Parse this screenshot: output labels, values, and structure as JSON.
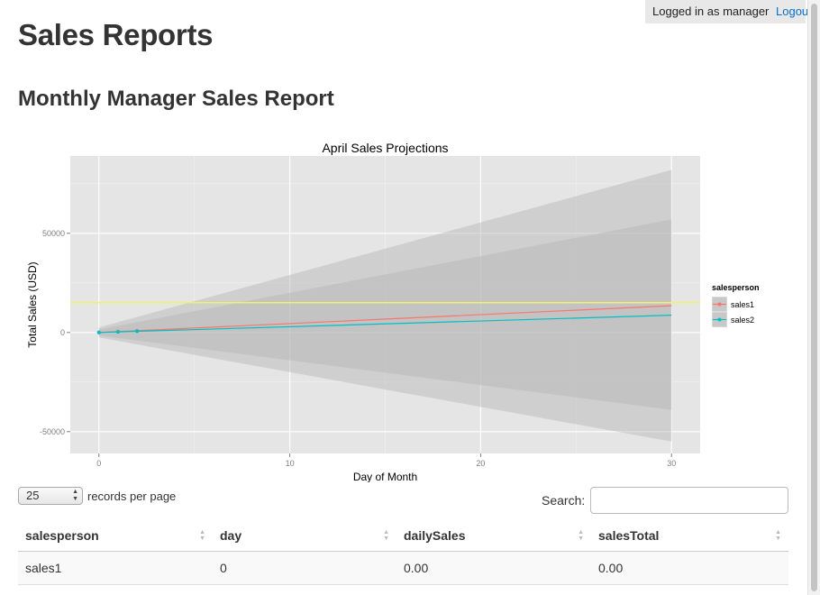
{
  "header": {
    "login_text": "Logged in as manager",
    "logout_label": "Logout",
    "page_title": "Sales Reports",
    "report_title": "Monthly Manager Sales Report"
  },
  "chart_data": {
    "type": "line",
    "title": "April Sales Projections",
    "xlabel": "Day of Month",
    "ylabel": "Total Sales (USD)",
    "xlim": [
      -1.5,
      31.5
    ],
    "ylim": [
      -61000,
      89000
    ],
    "x_ticks": [
      0,
      10,
      20,
      30
    ],
    "y_ticks": [
      -50000,
      0,
      50000
    ],
    "y_tick_labels": [
      "-50000",
      "0",
      "50000"
    ],
    "grid": true,
    "legend": {
      "title": "salesperson",
      "position": "right"
    },
    "reference_line": {
      "y": 15000,
      "color": "#f2f26a"
    },
    "series": [
      {
        "name": "sales1",
        "color": "#f8766d",
        "points": [
          [
            0,
            0
          ],
          [
            1,
            500
          ],
          [
            2,
            900
          ]
        ],
        "fit": [
          [
            0,
            0
          ],
          [
            30,
            13500
          ]
        ],
        "ribbon": [
          [
            0,
            2500,
            -2500
          ],
          [
            30,
            82000,
            -55000
          ]
        ]
      },
      {
        "name": "sales2",
        "color": "#00bfc4",
        "points": [
          [
            0,
            0
          ],
          [
            1,
            300
          ],
          [
            2,
            600
          ]
        ],
        "fit": [
          [
            0,
            0
          ],
          [
            30,
            8700
          ]
        ],
        "ribbon": [
          [
            0,
            1500,
            -1500
          ],
          [
            30,
            57000,
            -39000
          ]
        ]
      }
    ]
  },
  "table_controls": {
    "page_length": "25",
    "records_label": "records per page",
    "search_label": "Search:",
    "search_value": ""
  },
  "table": {
    "columns": [
      "salesperson",
      "day",
      "dailySales",
      "salesTotal"
    ],
    "rows": [
      [
        "sales1",
        "0",
        "0.00",
        "0.00"
      ]
    ]
  },
  "colors": {
    "panel_bg": "#e5e5e5",
    "ribbon": "#b3b3b3",
    "link": "#0a6fc2"
  }
}
